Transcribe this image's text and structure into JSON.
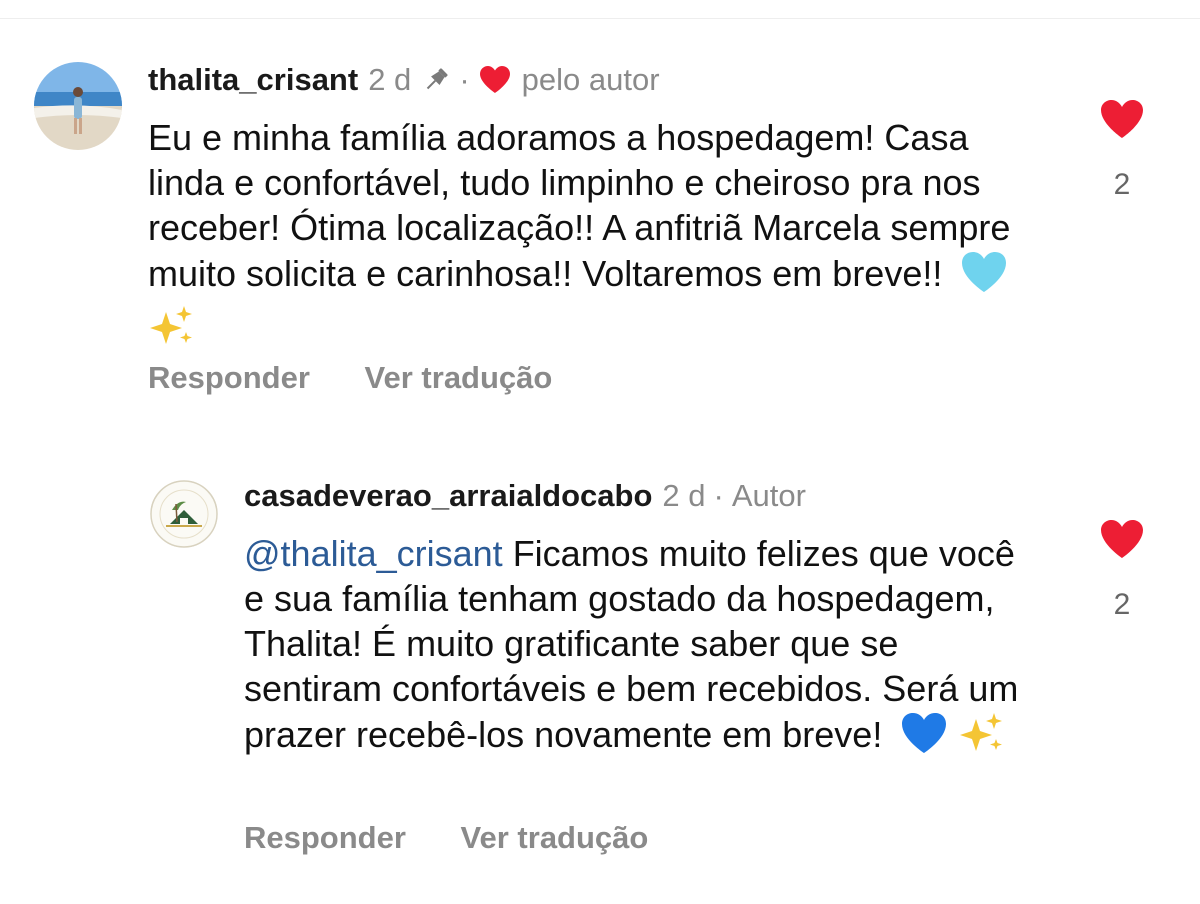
{
  "comments": [
    {
      "username": "thalita_crisant",
      "time": "2 d",
      "separator": "·",
      "liked_by": "pelo autor",
      "text": "Eu e minha família adoramos a hospedagem! Casa linda e confortável, tudo limpinho e cheiroso pra nos receber! Ótima localização!! A anfitriã Marcela sempre muito solicita e carinhosa!! Voltaremos em breve!!",
      "emojis": [
        "light-blue-heart",
        "sparkles"
      ],
      "likes": "2",
      "reply_label": "Responder",
      "translate_label": "Ver tradução"
    },
    {
      "username": "casadeverao_arraialdocabo",
      "time": "2 d",
      "separator": "·",
      "badge": "Autor",
      "mention": "@thalita_crisant",
      "text": "Ficamos muito felizes que você e sua família tenham gostado da hospedagem, Thalita! É muito gratificante saber que se sentiram confortáveis e bem recebidos. Será um prazer recebê-los novamente em breve!",
      "emojis": [
        "blue-heart",
        "sparkles"
      ],
      "likes": "2",
      "reply_label": "Responder",
      "translate_label": "Ver tradução",
      "avatar_logo_top": "CASA DE VERÃO",
      "avatar_logo_bottom": "ARRAIAL DO CABO"
    }
  ],
  "colors": {
    "heart_red": "#ed1e34",
    "mention_blue": "#2c5b96",
    "muted_gray": "#8a8a8a"
  }
}
